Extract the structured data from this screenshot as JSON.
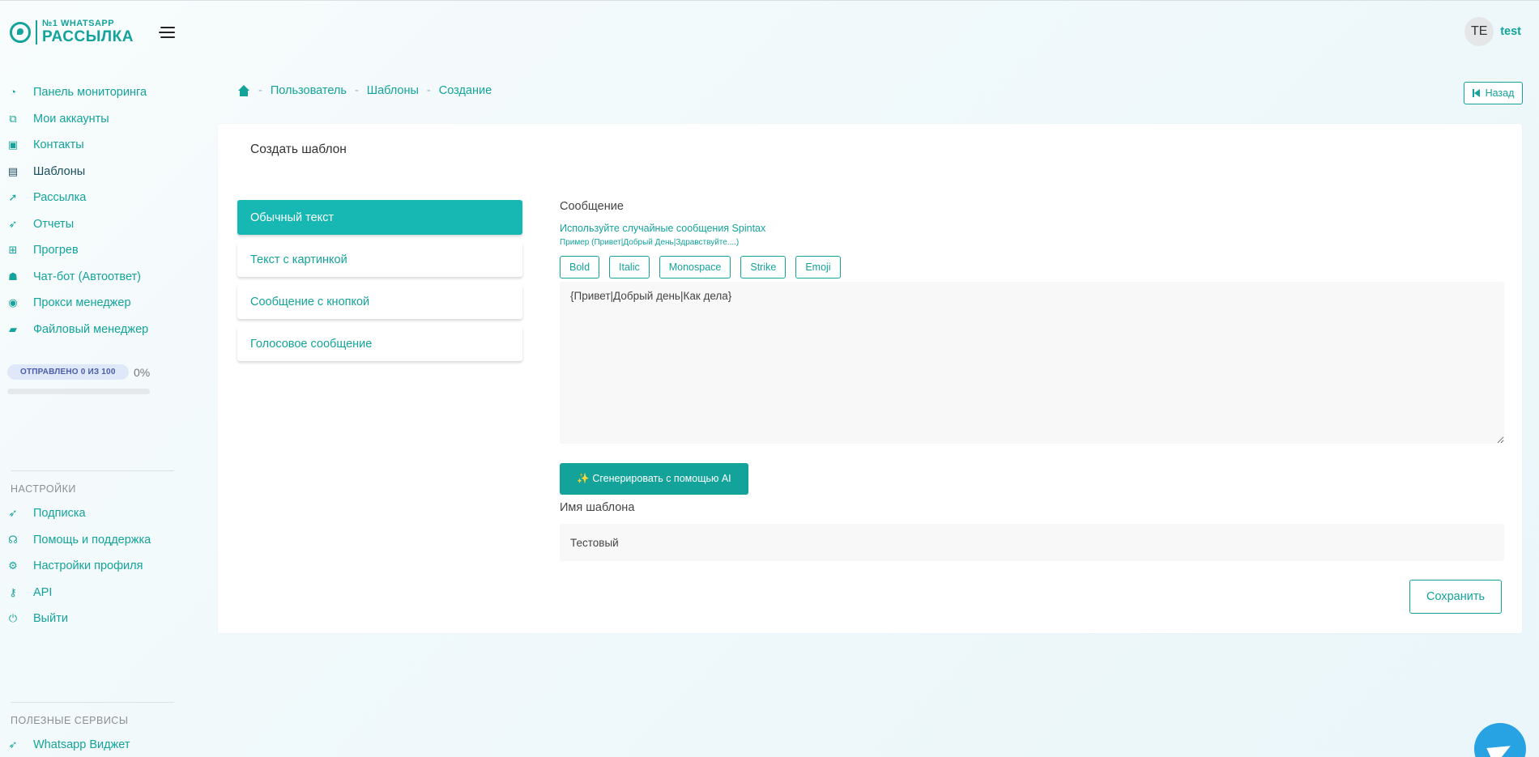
{
  "brand": {
    "line1": "WHATSAPP",
    "line2": "РАССЫЛКА",
    "badge": "№1",
    "color": "#14a39a"
  },
  "sidebar": {
    "items": [
      {
        "label": "Панель мониторинга",
        "icon": "gauge-icon"
      },
      {
        "label": "Мои аккаунты",
        "icon": "accounts-icon"
      },
      {
        "label": "Контакты",
        "icon": "contacts-icon"
      },
      {
        "label": "Шаблоны",
        "icon": "templates-icon",
        "active": true
      },
      {
        "label": "Рассылка",
        "icon": "send-icon"
      },
      {
        "label": "Отчеты",
        "icon": "rocket-icon"
      },
      {
        "label": "Прогрев",
        "icon": "grid-icon"
      },
      {
        "label": "Чат-бот (Автоответ)",
        "icon": "robot-icon"
      },
      {
        "label": "Прокси менеджер",
        "icon": "proxy-icon"
      },
      {
        "label": "Файловый менеджер",
        "icon": "folder-icon"
      }
    ],
    "sent": {
      "label": "ОТПРАВЛЕНО 0 ИЗ 100",
      "percent": "0%",
      "progress": 0
    },
    "settings_title": "НАСТРОЙКИ",
    "settings_items": [
      {
        "label": "Подписка",
        "icon": "rocket-icon"
      },
      {
        "label": "Помощь и поддержка",
        "icon": "headset-icon"
      },
      {
        "label": "Настройки профиля",
        "icon": "gear-icon"
      },
      {
        "label": "API",
        "icon": "key-icon"
      },
      {
        "label": "Выйти",
        "icon": "power-icon"
      }
    ],
    "services_title": "ПОЛЕЗНЫЕ СЕРВИСЫ",
    "services_items": [
      {
        "label": "Whatsapp Виджет",
        "icon": "rocket-icon"
      }
    ]
  },
  "header": {
    "avatar_initials": "TE",
    "username": "test"
  },
  "breadcrumb": {
    "items": [
      "Пользователь",
      "Шаблоны",
      "Создание"
    ],
    "back_label": "Назад"
  },
  "card": {
    "title": "Создать шаблон",
    "tabs": [
      {
        "label": "Обычный текст",
        "active": true
      },
      {
        "label": "Текст с картинкой"
      },
      {
        "label": "Сообщение с кнопкой"
      },
      {
        "label": "Голосовое сообщение"
      }
    ],
    "message_label": "Сообщение",
    "spintax_hint": "Используйте случайные сообщения Spintax",
    "spintax_example": "Пример (Привет|Добрый День|Здравствуйте....)",
    "format_buttons": [
      "Bold",
      "Italic",
      "Monospace",
      "Strike",
      "Emoji"
    ],
    "message_value": "{Привет|Добрый день|Как дела}",
    "ai_button": "✨ Сгенерировать с помощью AI",
    "name_label": "Имя шаблона",
    "name_value": "Тестовый",
    "save_label": "Сохранить"
  }
}
